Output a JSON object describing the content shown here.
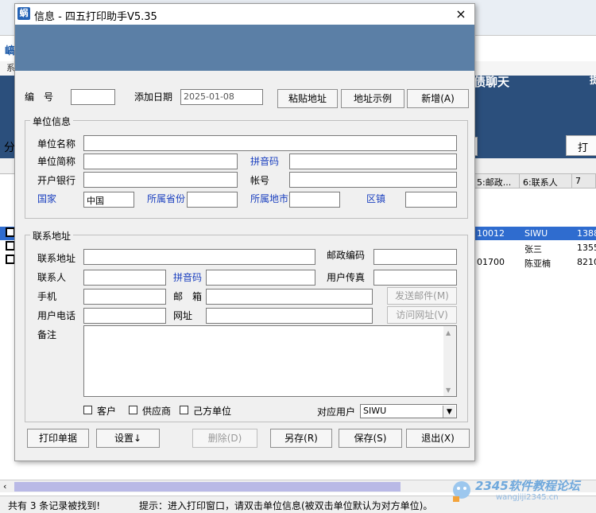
{
  "background_window": {
    "menu_partial": "系",
    "banner_text": "债聊天",
    "banner_right_1": "如",
    "banner_right_2": "提",
    "side_label": "分",
    "print_button": "打",
    "grid_headers": [
      "5:邮政...",
      "6:联系人",
      "7"
    ],
    "grid_rows": [
      {
        "postal": "10012",
        "contact": "SIWU",
        "phone": "1388"
      },
      {
        "postal": "",
        "contact": "张三",
        "phone": "1355"
      },
      {
        "postal": "01700",
        "contact": "陈亚楠",
        "phone": "8210"
      }
    ],
    "status_left": "共有 3 条记录被找到!",
    "status_hint": "提示：进入打印窗口，请双击单位信息(被双击单位默认为对方单位)。",
    "watermark_logo": "2345软件教程论坛",
    "watermark_url": "wangjiji2345.cn"
  },
  "dialog": {
    "icon_label": "蜗",
    "title": "信息 - 四五打印助手V5.35",
    "close_label": "×",
    "top": {
      "bianhao_label": "编　号",
      "bianhao_value": "",
      "date_label": "添加日期",
      "date_value": "2025-01-08",
      "paste_button": "粘贴地址",
      "example_button": "地址示例",
      "add_button": "新增(A)"
    },
    "unit_group": {
      "title": "单位信息",
      "name_label": "单位名称",
      "short_label": "单位简称",
      "pinyin_label": "拼音码",
      "bank_label": "开户银行",
      "account_label": "帐号",
      "country_label": "国家",
      "country_value": "中国",
      "province_label": "所属省份",
      "city_label": "所属地市",
      "district_label": "区镇"
    },
    "contact_group": {
      "title": "联系地址",
      "address_label": "联系地址",
      "postcode_label": "邮政编码",
      "person_label": "联系人",
      "pinyin_label": "拼音码",
      "fax_label": "用户传真",
      "mobile_label": "手机",
      "email_label": "邮　箱",
      "send_mail_button": "发送邮件(M)",
      "phone_label": "用户电话",
      "website_label": "网址",
      "visit_site_button": "访问网址(V)",
      "note_label": "备注",
      "customer_label": "客户",
      "supplier_label": "供应商",
      "self_label": "己方单位",
      "user_label": "对应用户",
      "user_value": "SIWU"
    },
    "bottom_buttons": {
      "print": "打印单据",
      "settings": "设置↓",
      "delete": "删除(D)",
      "save_as": "另存(R)",
      "save": "保存(S)",
      "exit": "退出(X)"
    }
  }
}
